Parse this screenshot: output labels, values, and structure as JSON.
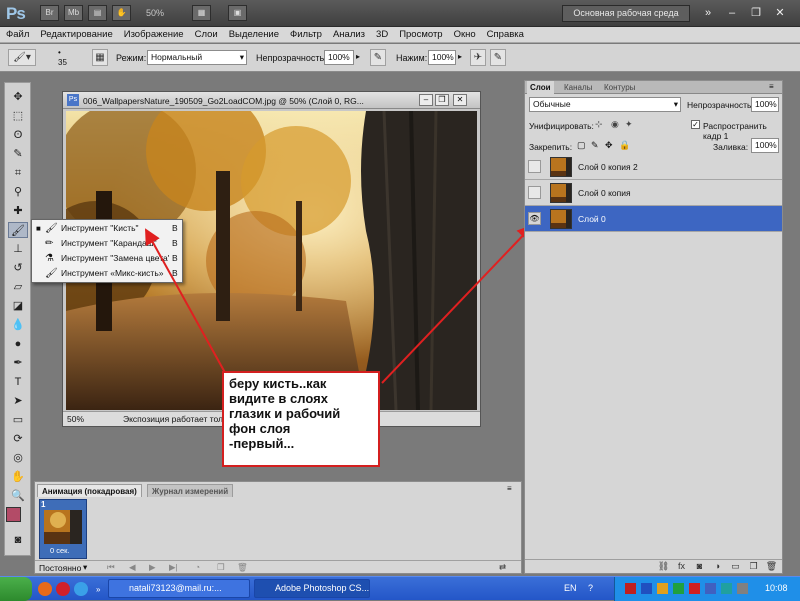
{
  "app": {
    "logo": "Ps",
    "bridge_btn": "Br",
    "minibridge_btn": "Mb",
    "zoom": "50%",
    "workspace": "Основная рабочая среда"
  },
  "menu": [
    "Файл",
    "Редактирование",
    "Изображение",
    "Слои",
    "Выделение",
    "Фильтр",
    "Анализ",
    "3D",
    "Просмотр",
    "Окно",
    "Справка"
  ],
  "options": {
    "brush_size": "35",
    "mode_label": "Режим:",
    "mode_value": "Нормальный",
    "opacity_label": "Непрозрачность:",
    "opacity_value": "100%",
    "pressure_label": "Нажим:",
    "pressure_value": "100%"
  },
  "document": {
    "title": "006_WallpapersNature_190509_Go2LoadCOM.jpg @ 50% (Слой 0, RG...",
    "status_zoom": "50%",
    "status_text": "Экспозиция работает толь"
  },
  "flyout": {
    "items": [
      {
        "label": "Инструмент \"Кисть\"",
        "key": "B",
        "icon": "brush-icon",
        "active": true
      },
      {
        "label": "Инструмент \"Карандаш\"",
        "key": "B",
        "icon": "pencil-icon",
        "active": false
      },
      {
        "label": "Инструмент \"Замена цвета\"",
        "key": "B",
        "icon": "color-replace-icon",
        "active": false
      },
      {
        "label": "Инструмент «Микс-кисть»",
        "key": "B",
        "icon": "mixer-brush-icon",
        "active": false
      }
    ]
  },
  "callout": {
    "lines": [
      "беру кисть..как",
      "видите в слоях",
      "глазик и рабочий",
      "фон слоя",
      "-первый..."
    ],
    "border_color": "#d41f1f"
  },
  "animation": {
    "tab_active": "Анимация (покадровая)",
    "tab_other": "Журнал измерений",
    "frame_number": "1",
    "frame_delay": "0 сек.",
    "loop": "Постоянно"
  },
  "layers": {
    "tabs": [
      "Слои",
      "Каналы",
      "Контуры"
    ],
    "blend_mode": "Обычные",
    "opacity_label": "Непрозрачность:",
    "opacity_value": "100%",
    "unify_label": "Унифицировать:",
    "propagate_label": "Распространить кадр 1",
    "lock_label": "Закрепить:",
    "fill_label": "Заливка:",
    "fill_value": "100%",
    "items": [
      {
        "name": "Слой 0 копия 2",
        "visible": false,
        "selected": false
      },
      {
        "name": "Слой 0 копия",
        "visible": false,
        "selected": false
      },
      {
        "name": "Слой 0",
        "visible": true,
        "selected": true
      }
    ]
  },
  "taskbar": {
    "email_task": "natali73123@mail.ru:...",
    "ps_task": "Adobe Photoshop CS...",
    "lang": "EN",
    "clock": "10:08"
  },
  "colors": {
    "foreground": "#b34b67",
    "selection": "#3d66c2",
    "annotation": "#d41f1f"
  }
}
